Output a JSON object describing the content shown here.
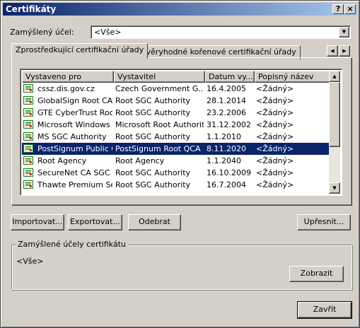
{
  "window": {
    "title": "Certifikáty",
    "help_btn": "?",
    "close_btn": "×"
  },
  "purpose": {
    "label": "Zamýšlený účel:",
    "selected": "<Vše>"
  },
  "tabs": [
    {
      "label": "Zprostředkující certifikační úřady",
      "active": true
    },
    {
      "label": "Důvěryhodné kořenové certifikační úřady",
      "active": false
    }
  ],
  "list": {
    "columns": [
      "Vystaveno pro",
      "Vystavitel",
      "Datum vy...",
      "Popisný název"
    ],
    "rows": [
      {
        "issued_to": "cssz.dis.gov.cz",
        "issuer": "Czech Government G...",
        "date": "16.4.2005",
        "friendly": "<Žádný>",
        "selected": false
      },
      {
        "issued_to": "GlobalSign Root CA",
        "issuer": "Root SGC Authority",
        "date": "28.1.2014",
        "friendly": "<Žádný>",
        "selected": false
      },
      {
        "issued_to": "GTE CyberTrust Root",
        "issuer": "Root SGC Authority",
        "date": "23.2.2006",
        "friendly": "<Žádný>",
        "selected": false
      },
      {
        "issued_to": "Microsoft Windows ...",
        "issuer": "Microsoft Root Authority",
        "date": "31.12.2002",
        "friendly": "<Žádný>",
        "selected": false
      },
      {
        "issued_to": "MS SGC Authority",
        "issuer": "Root SGC Authority",
        "date": "1.1.2010",
        "friendly": "<Žádný>",
        "selected": false
      },
      {
        "issued_to": "PostSignum Public CA",
        "issuer": "PostSignum Root QCA",
        "date": "8.11.2020",
        "friendly": "<Žádný>",
        "selected": true
      },
      {
        "issued_to": "Root Agency",
        "issuer": "Root Agency",
        "date": "1.1.2040",
        "friendly": "<Žádný>",
        "selected": false
      },
      {
        "issued_to": "SecureNet CA SGC ...",
        "issuer": "Root SGC Authority",
        "date": "16.10.2009",
        "friendly": "<Žádný>",
        "selected": false
      },
      {
        "issued_to": "Thawte Premium Se...",
        "issuer": "Root SGC Authority",
        "date": "16.7.2004",
        "friendly": "<Žádný>",
        "selected": false
      }
    ]
  },
  "buttons": {
    "import": "Importovat...",
    "export": "Exportovat...",
    "remove": "Odebrat",
    "advanced": "Upřesnit...",
    "view": "Zobrazit",
    "close": "Zavřít"
  },
  "purposes_group": {
    "title": "Zamýšlené účely certifikátu",
    "value": "<Vše>"
  },
  "colors": {
    "face": "#d4d0c8",
    "selection": "#0a246a",
    "title_start": "#0a246a",
    "title_end": "#a6caf0"
  }
}
